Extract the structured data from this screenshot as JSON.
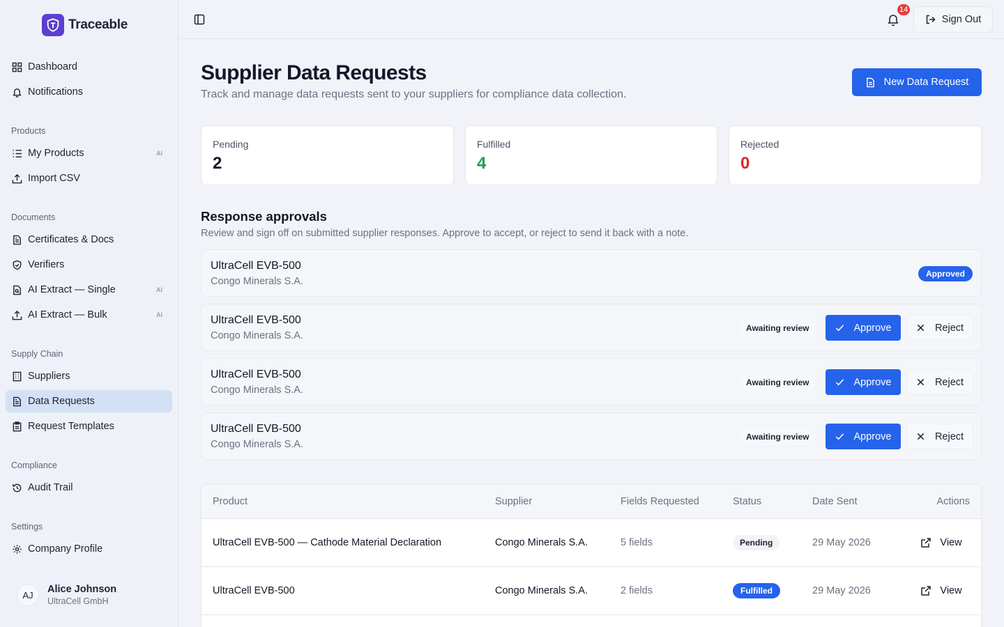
{
  "app": {
    "name": "Traceable"
  },
  "sidebar": {
    "top_items": [
      {
        "label": "Dashboard",
        "icon": "dashboard-grid-icon"
      },
      {
        "label": "Notifications",
        "icon": "bell-icon"
      }
    ],
    "sections": [
      {
        "title": "Products",
        "items": [
          {
            "label": "My Products",
            "icon": "list-icon",
            "badge": "AI"
          },
          {
            "label": "Import CSV",
            "icon": "upload-icon"
          }
        ]
      },
      {
        "title": "Documents",
        "items": [
          {
            "label": "Certificates & Docs",
            "icon": "document-icon"
          },
          {
            "label": "Verifiers",
            "icon": "shield-icon"
          },
          {
            "label": "AI Extract — Single",
            "icon": "document-scan-icon",
            "badge": "AI"
          },
          {
            "label": "AI Extract — Bulk",
            "icon": "upload-icon",
            "badge": "AI"
          }
        ]
      },
      {
        "title": "Supply Chain",
        "items": [
          {
            "label": "Suppliers",
            "icon": "building-icon"
          },
          {
            "label": "Data Requests",
            "icon": "document-icon",
            "active": true
          },
          {
            "label": "Request Templates",
            "icon": "clipboard-icon"
          }
        ]
      },
      {
        "title": "Compliance",
        "items": [
          {
            "label": "Audit Trail",
            "icon": "history-icon"
          }
        ]
      },
      {
        "title": "Settings",
        "items": [
          {
            "label": "Company Profile",
            "icon": "gear-icon"
          }
        ]
      }
    ],
    "user": {
      "initials": "AJ",
      "name": "Alice Johnson",
      "org": "UltraCell GmbH"
    }
  },
  "topbar": {
    "notification_count": "14",
    "sign_out_label": "Sign Out"
  },
  "page": {
    "title": "Supplier Data Requests",
    "subtitle": "Track and manage data requests sent to your suppliers for compliance data collection.",
    "new_request_label": "New Data Request"
  },
  "stats": [
    {
      "label": "Pending",
      "value": "2",
      "color": "#111827"
    },
    {
      "label": "Fulfilled",
      "value": "4",
      "color": "#16a34a"
    },
    {
      "label": "Rejected",
      "value": "0",
      "color": "#dc2626"
    }
  ],
  "approvals": {
    "title": "Response approvals",
    "subtitle": "Review and sign off on submitted supplier responses. Approve to accept, or reject to send it back with a note.",
    "approve_label": "Approve",
    "reject_label": "Reject",
    "rows": [
      {
        "product": "UltraCell EVB-500",
        "supplier": "Congo Minerals S.A.",
        "status": "Approved"
      },
      {
        "product": "UltraCell EVB-500",
        "supplier": "Congo Minerals S.A.",
        "status": "Awaiting review"
      },
      {
        "product": "UltraCell EVB-500",
        "supplier": "Congo Minerals S.A.",
        "status": "Awaiting review"
      },
      {
        "product": "UltraCell EVB-500",
        "supplier": "Congo Minerals S.A.",
        "status": "Awaiting review"
      }
    ]
  },
  "table": {
    "headers": [
      "Product",
      "Supplier",
      "Fields Requested",
      "Status",
      "Date Sent",
      "Actions"
    ],
    "view_label": "View",
    "rows": [
      {
        "product": "UltraCell EVB-500 — Cathode Material Declaration",
        "supplier": "Congo Minerals S.A.",
        "fields": "5 fields",
        "status": "Pending",
        "date": "29 May 2026"
      },
      {
        "product": "UltraCell EVB-500",
        "supplier": "Congo Minerals S.A.",
        "fields": "2 fields",
        "status": "Fulfilled",
        "date": "29 May 2026"
      }
    ]
  },
  "colors": {
    "accent": "#2563eb",
    "brand": "#5b3fd1",
    "active_nav": "#d4e1f5"
  }
}
